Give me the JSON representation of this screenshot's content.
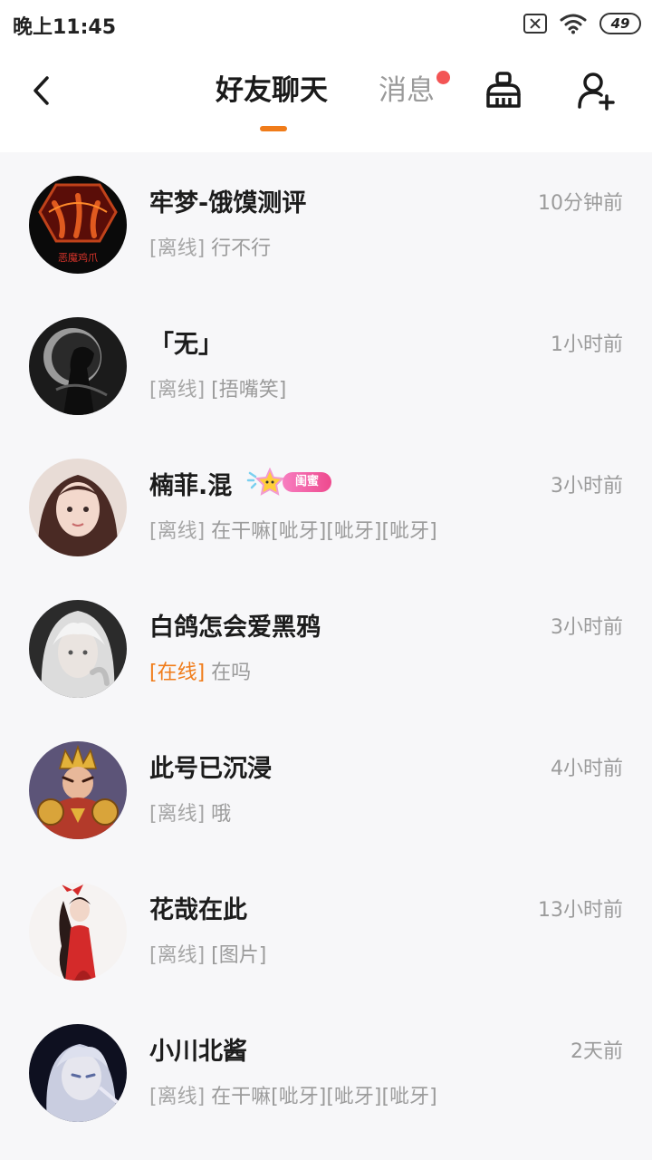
{
  "status_bar": {
    "time": "晚上11:45",
    "battery": "49"
  },
  "header": {
    "tab_friends": "好友聊天",
    "tab_messages": "消息"
  },
  "chats": [
    {
      "name": "牢梦-饿馍测评",
      "time": "10分钟前",
      "status": "[离线]",
      "status_type": "offline",
      "message": "行不行",
      "avatar_text": "恶魔鸡爪"
    },
    {
      "name": "「无」",
      "time": "1小时前",
      "status": "[离线]",
      "status_type": "offline",
      "message": "[捂嘴笑]"
    },
    {
      "name": "楠菲.混",
      "time": "3小时前",
      "status": "[离线]",
      "status_type": "offline",
      "message": "在干嘛[呲牙][呲牙][呲牙]",
      "badge": "闺蜜"
    },
    {
      "name": "白鸽怎会爱黑鸦",
      "time": "3小时前",
      "status": "[在线]",
      "status_type": "online",
      "message": "在吗"
    },
    {
      "name": "此号已沉浸",
      "time": "4小时前",
      "status": "[离线]",
      "status_type": "offline",
      "message": "哦"
    },
    {
      "name": "花哉在此",
      "time": "13小时前",
      "status": "[离线]",
      "status_type": "offline",
      "message": "[图片]"
    },
    {
      "name": "小川北酱",
      "time": "2天前",
      "status": "[离线]",
      "status_type": "offline",
      "message": "在干嘛[呲牙][呲牙][呲牙]"
    }
  ],
  "colors": {
    "accent": "#f07c1a",
    "unread_dot": "#f35454",
    "muted_text": "#9b9b9b",
    "badge_pink": "#ee4a8e"
  },
  "icons": {
    "back": "chevron-left-icon",
    "clean": "broom-icon",
    "add_friend": "add-user-icon"
  }
}
